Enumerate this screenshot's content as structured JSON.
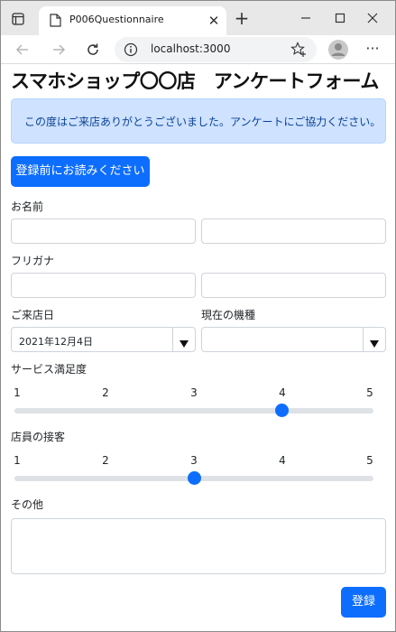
{
  "browser": {
    "tab_title": "P006Questionnaire",
    "url": "localhost:3000"
  },
  "page": {
    "title": "スマホショップ〇〇店　アンケートフォーム",
    "alert": "この度はご来店ありがとうございました。アンケートにご協力ください。",
    "readme_button": "登録前にお読みください",
    "name_label": "お名前",
    "furigana_label": "フリガナ",
    "visit_date_label": "ご来店日",
    "visit_date_value": "2021年12月4日",
    "device_label": "現在の機種",
    "device_value": "",
    "satisfaction": {
      "label": "サービス満足度",
      "scale": [
        "1",
        "2",
        "3",
        "4",
        "5"
      ],
      "value": 4
    },
    "staff": {
      "label": "店員の接客",
      "scale": [
        "1",
        "2",
        "3",
        "4",
        "5"
      ],
      "value": 3
    },
    "other_label": "その他",
    "submit_button": "登録"
  }
}
